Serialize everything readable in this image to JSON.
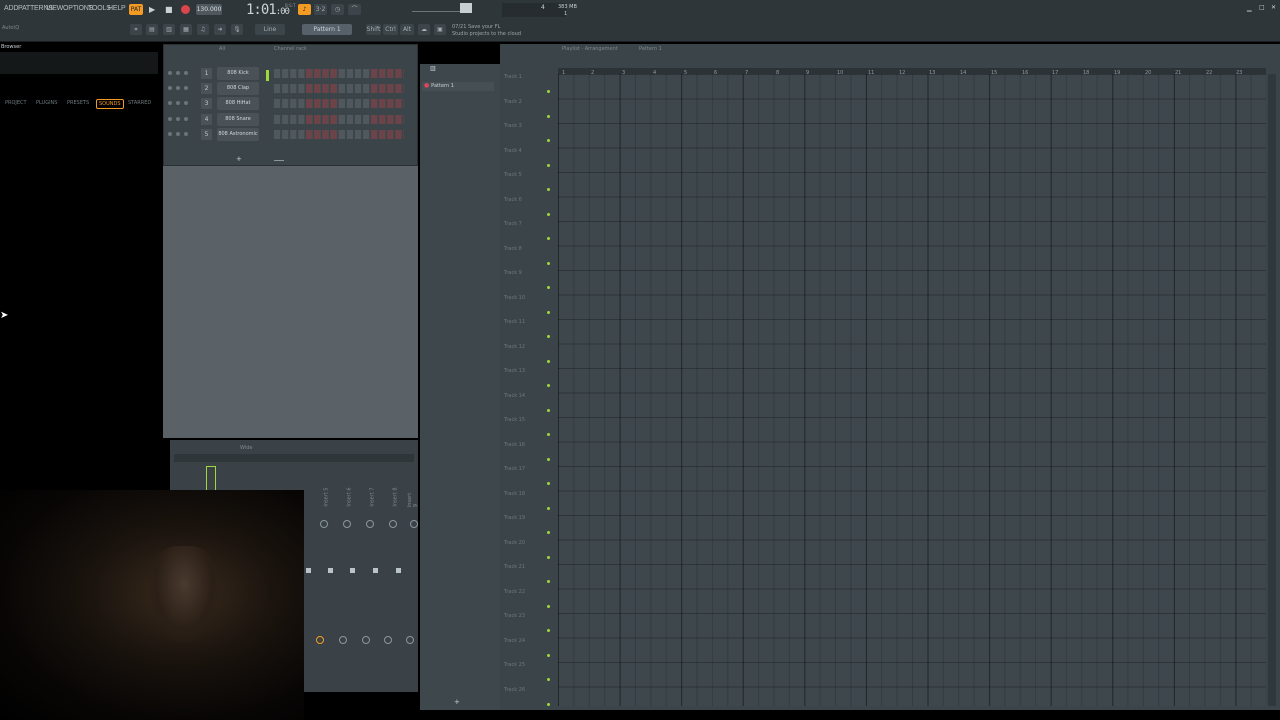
{
  "menu": [
    "ADD",
    "PATTERNS",
    "VIEW",
    "OPTIONS",
    "TOOLS",
    "HELP"
  ],
  "transport": {
    "tempo": "130.000",
    "time": "1:01",
    "time_sub": ":00",
    "bst": "B:S:T",
    "pattern": "Pattern 1",
    "snap": "Line",
    "memory": "383 MB",
    "cpu": "4",
    "counter": "1"
  },
  "hint": {
    "line1": "07/21  Save your FL",
    "line2": "Studio projects to the cloud"
  },
  "toolbar": {
    "shift": "Shift",
    "ctrl": "Ctrl",
    "alt": "Alt"
  },
  "browser": {
    "title": "Browser",
    "path": "Auto\\Q",
    "tabs": [
      "PROJECT",
      "PLUGINS",
      "PRESETS",
      "SOUNDS",
      "STARRED"
    ]
  },
  "channel_rack": {
    "title": "Channel rack",
    "filter": "All",
    "channels": [
      {
        "num": "1",
        "name": "808 Kick"
      },
      {
        "num": "2",
        "name": "808 Clap"
      },
      {
        "num": "3",
        "name": "808 HiHat"
      },
      {
        "num": "4",
        "name": "808 Snare"
      },
      {
        "num": "5",
        "name": "808 Astronomic"
      }
    ],
    "add": "+"
  },
  "mixer": {
    "title": "Wide",
    "inserts": [
      "Insert 5",
      "Insert 6",
      "Insert 7",
      "Insert 8",
      "Insert 9"
    ]
  },
  "patterns": {
    "items": [
      "Pattern 1"
    ],
    "add": "+"
  },
  "playlist": {
    "title": "Playlist - Arrangement",
    "crumb": "Pattern 1",
    "ruler": [
      "1",
      "2",
      "3",
      "4",
      "5",
      "6",
      "7",
      "8",
      "9",
      "10",
      "11",
      "12",
      "13",
      "14",
      "15",
      "16",
      "17",
      "18",
      "19",
      "20",
      "21",
      "22",
      "23"
    ],
    "tracks": [
      "Track 1",
      "Track 2",
      "Track 3",
      "Track 4",
      "Track 5",
      "Track 6",
      "Track 7",
      "Track 8",
      "Track 9",
      "Track 10",
      "Track 11",
      "Track 12",
      "Track 13",
      "Track 14",
      "Track 15",
      "Track 16",
      "Track 17",
      "Track 18",
      "Track 19",
      "Track 20",
      "Track 21",
      "Track 22",
      "Track 23",
      "Track 24",
      "Track 25",
      "Track 26"
    ]
  },
  "colors": {
    "accent": "#f39b22",
    "led_green": "#9fd83b",
    "panel": "#3a4449"
  }
}
